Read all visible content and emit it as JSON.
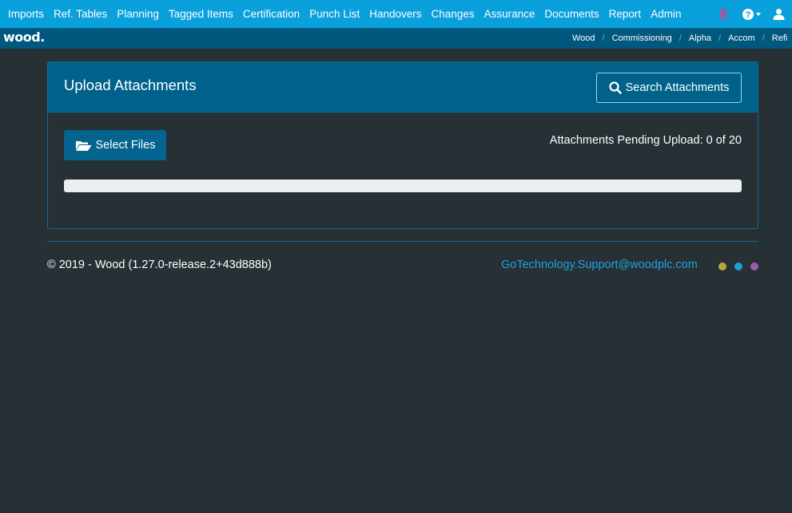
{
  "nav": {
    "items": [
      "Imports",
      "Ref. Tables",
      "Planning",
      "Tagged Items",
      "Certification",
      "Punch List",
      "Handovers",
      "Changes",
      "Assurance",
      "Documents",
      "Report",
      "Admin"
    ],
    "icons": {
      "notifications": "bell-icon",
      "help": "question-circle-icon",
      "user": "user-icon"
    },
    "bell_color": "#a05aa3"
  },
  "subbar": {
    "logo": "wood.",
    "breadcrumb": [
      "Wood",
      "Commissioning",
      "Alpha",
      "Accom",
      "Refi"
    ],
    "separator": "/"
  },
  "upload": {
    "title": "Upload Attachments",
    "search_label": "Search Attachments",
    "select_label": "Select Files",
    "pending_text": "Attachments Pending Upload: 0 of 20",
    "progress": 0
  },
  "footer": {
    "copyright": "© 2019 - Wood (1.27.0-release.2+43d888b)",
    "support_email": "GoTechnology.Support@woodplc.com",
    "dot_colors": [
      "#b7a63c",
      "#19a4cf",
      "#a05aa3"
    ]
  },
  "colors": {
    "accent": "#0aa0dc",
    "subbar": "#00587f",
    "panel_header": "#00618b",
    "background": "#263035"
  }
}
